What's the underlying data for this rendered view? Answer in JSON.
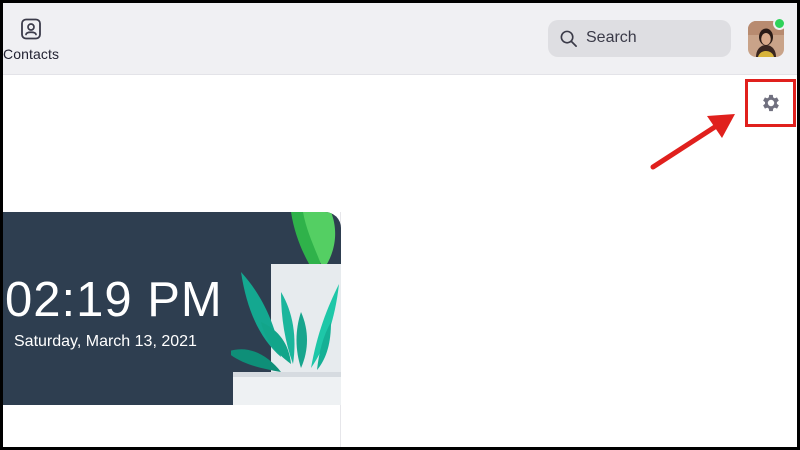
{
  "topbar": {
    "contacts_label": "Contacts",
    "contacts_icon": "contacts-icon",
    "search": {
      "label": "Search",
      "icon": "search-icon"
    },
    "avatar": {
      "icon": "avatar",
      "status": "online",
      "status_color": "#2fd25a"
    }
  },
  "settings": {
    "icon": "gear-icon",
    "highlight_color": "#e0201d"
  },
  "annotation": {
    "arrow_color": "#e0201d"
  },
  "clock_card": {
    "time": "02:19 PM",
    "date": "Saturday, March 13, 2021",
    "banner_color": "#2e3e50"
  }
}
